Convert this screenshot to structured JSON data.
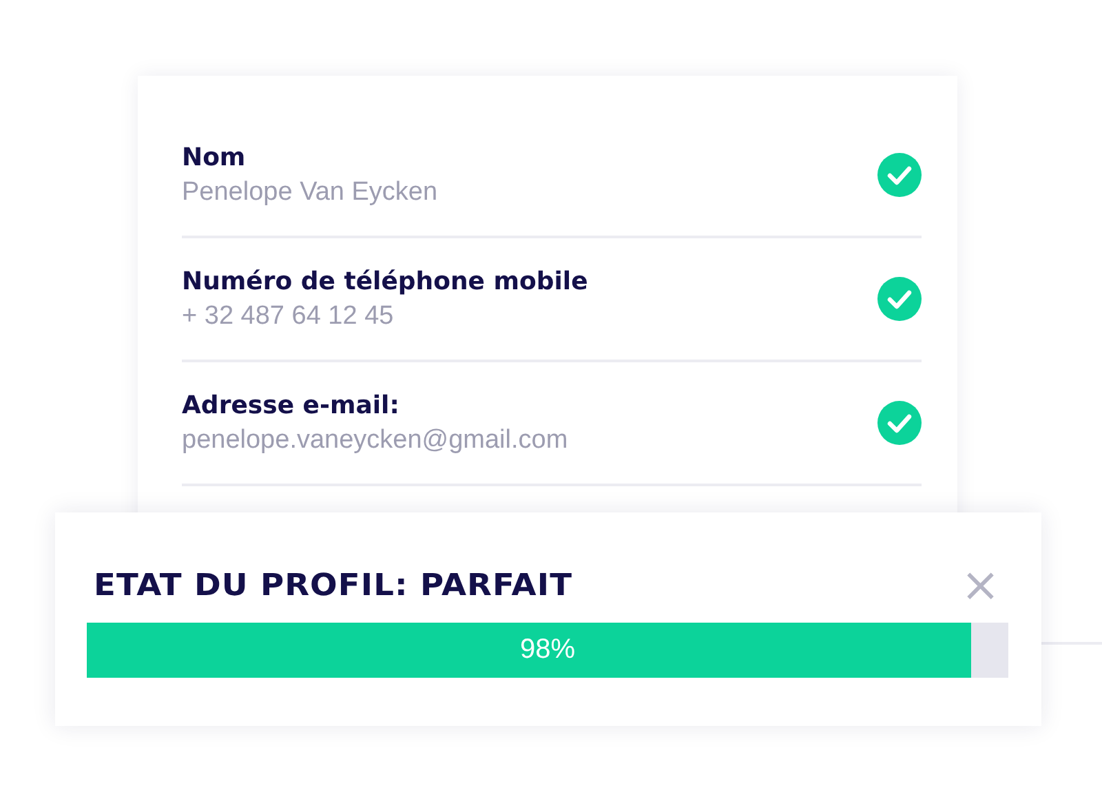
{
  "fields": [
    {
      "label": "Nom",
      "value": "Penelope Van Eycken",
      "verified": true
    },
    {
      "label": "Numéro de téléphone mobile",
      "value": "+ 32 487 64 12 45",
      "verified": true
    },
    {
      "label": "Adresse e-mail:",
      "value": "penelope.vaneycken@gmail.com",
      "verified": true
    }
  ],
  "status": {
    "title": "ETAT DU PROFIL: PARFAIT",
    "close": "×",
    "level": 0.96,
    "reading": "98%"
  }
}
